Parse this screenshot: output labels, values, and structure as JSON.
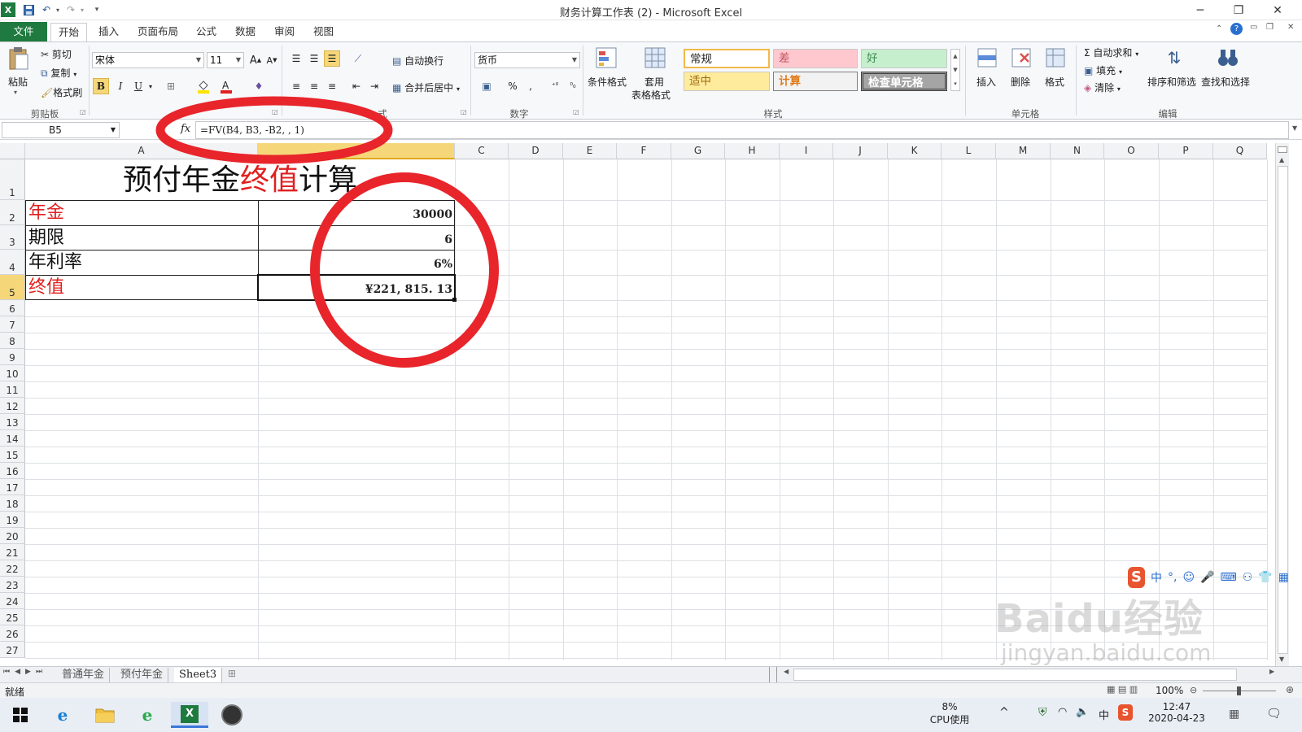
{
  "window": {
    "title": "财务计算工作表 (2) - Microsoft Excel",
    "qat_icons": [
      "excel-icon",
      "save-icon",
      "undo-icon",
      "redo-icon",
      "customize-icon"
    ],
    "controls": {
      "minimize": "─",
      "restore": "❐",
      "close": "✕"
    }
  },
  "tabs": [
    "文件",
    "开始",
    "插入",
    "页面布局",
    "公式",
    "数据",
    "审阅",
    "视图"
  ],
  "ribbon": {
    "clipboard": {
      "paste": "粘贴",
      "cut": "剪切",
      "copy": "复制",
      "format_painter": "格式刷",
      "label": "剪贴板"
    },
    "font": {
      "name": "宋体",
      "size": "11",
      "bold": "B",
      "italic": "I",
      "underline": "U",
      "grow": "A",
      "shrink": "A"
    },
    "alignment": {
      "wrap": "自动换行",
      "merge": "合并后居中",
      "label_tail": "式"
    },
    "number": {
      "format": "货币",
      "percent": "%",
      "comma": ",",
      "label": "数字"
    },
    "styles": {
      "conditional": "条件格式",
      "table_format_1": "套用",
      "table_format_2": "表格格式",
      "normal": "常规",
      "bad": "差",
      "good": "好",
      "neutral": "适中",
      "calc": "计算",
      "check": "检查单元格",
      "label": "样式"
    },
    "cells": {
      "insert": "插入",
      "delete": "删除",
      "format": "格式",
      "label": "单元格"
    },
    "editing": {
      "autosum": "自动求和",
      "fill": "填充",
      "clear": "清除",
      "sort_filter": "排序和筛选",
      "find_select": "查找和选择",
      "label": "编辑"
    }
  },
  "formula_bar": {
    "name_box": "B5",
    "fx": "fx",
    "formula": "=FV(B4, B3, -B2, , 1)"
  },
  "columns": [
    "A",
    "B",
    "C",
    "D",
    "E",
    "F",
    "G",
    "H",
    "I",
    "J",
    "K",
    "L",
    "M",
    "N",
    "O",
    "P",
    "Q"
  ],
  "rows": [
    "1",
    "2",
    "3",
    "4",
    "5",
    "6",
    "7",
    "8",
    "9",
    "10",
    "11",
    "12",
    "13",
    "14",
    "15",
    "16",
    "17",
    "18",
    "19",
    "20",
    "21",
    "22",
    "23",
    "24",
    "25",
    "26",
    "27"
  ],
  "sheet": {
    "title_part1": "预付年金",
    "title_part2": "终值",
    "title_part3": "计算",
    "rows": [
      {
        "label": "年金",
        "value": "30000",
        "label_color": "#e02020"
      },
      {
        "label": "期限",
        "value": "6",
        "label_color": "#111111"
      },
      {
        "label": "年利率",
        "value": "6%",
        "label_color": "#111111"
      },
      {
        "label": "终值",
        "value": "¥221, 815. 13",
        "label_color": "#e02020"
      }
    ]
  },
  "sheet_tabs": [
    "普通年金",
    "预付年金",
    "Sheet3"
  ],
  "status": {
    "ready": "就绪",
    "zoom": "100%"
  },
  "ime": {
    "lang": "中",
    "punct": "°,"
  },
  "watermark": {
    "brand": "Baidu经验",
    "url": "jingyan.baidu.com"
  },
  "taskbar": {
    "cpu_value": "8%",
    "cpu_label": "CPU使用",
    "time": "12:47",
    "date": "2020-04-23",
    "ime_lang": "中"
  },
  "colors": {
    "accent": "#1f7a3f",
    "annotation": "#e8252b",
    "red_text": "#e02020"
  }
}
